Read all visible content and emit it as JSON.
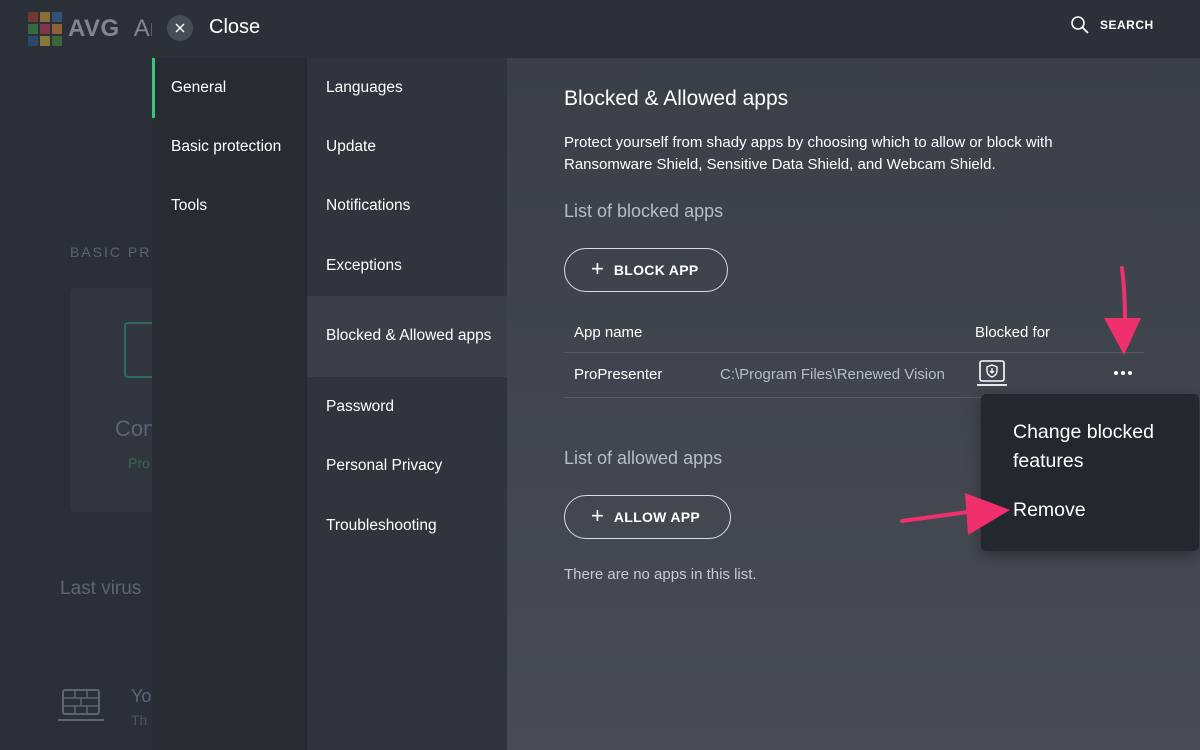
{
  "background": {
    "brand": "AVG",
    "app_name_partial": "An",
    "basic_protection_partial": "BASIC PR",
    "status_partial": "Con",
    "status_sub_partial": "Pro",
    "last_virus_partial": "Last virus",
    "firewall_title_partial": "Yo",
    "firewall_sub_partial": "Th"
  },
  "header": {
    "close_label": "Close",
    "search_label": "SEARCH"
  },
  "nav_primary": [
    {
      "label": "General",
      "active": true
    },
    {
      "label": "Basic protection",
      "active": false
    },
    {
      "label": "Tools",
      "active": false
    }
  ],
  "nav_secondary": [
    {
      "label": "Languages",
      "active": false
    },
    {
      "label": "Update",
      "active": false
    },
    {
      "label": "Notifications",
      "active": false
    },
    {
      "label": "Exceptions",
      "active": false
    },
    {
      "label": "Blocked & Allowed apps",
      "active": true
    },
    {
      "label": "Password",
      "active": false
    },
    {
      "label": "Personal Privacy",
      "active": false
    },
    {
      "label": "Troubleshooting",
      "active": false
    }
  ],
  "content": {
    "title": "Blocked & Allowed apps",
    "description": "Protect yourself from shady apps by choosing which to allow or block with Ransomware Shield, Sensitive Data Shield, and Webcam Shield.",
    "blocked_section": {
      "heading": "List of blocked apps",
      "button_label": "BLOCK APP",
      "columns": [
        "App name",
        "Blocked for"
      ],
      "rows": [
        {
          "name": "ProPresenter",
          "path": "C:\\Program Files\\Renewed Vision"
        }
      ]
    },
    "allowed_section": {
      "heading": "List of allowed apps",
      "button_label": "ALLOW APP",
      "empty_text": "There are no apps in this list."
    }
  },
  "context_menu": {
    "items": [
      "Change blocked features",
      "Remove"
    ]
  },
  "colors": {
    "accent_green": "#3ec27f",
    "annotation_pink": "#f0306d"
  }
}
